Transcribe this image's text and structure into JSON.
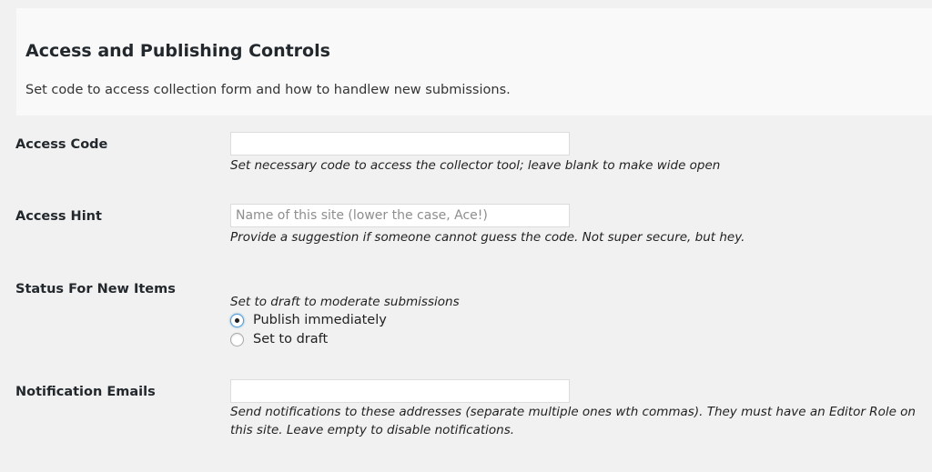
{
  "section": {
    "title": "Access and Publishing Controls",
    "description": "Set code to access collection form and how to handlew new submissions."
  },
  "access_code": {
    "label": "Access Code",
    "value": "",
    "help": "Set necessary code to access the collector tool; leave blank to make wide open"
  },
  "access_hint": {
    "label": "Access Hint",
    "placeholder": "Name of this site (lower the case, Ace!)",
    "help": "Provide a suggestion if someone cannot guess the code. Not super secure, but hey."
  },
  "status": {
    "label": "Status For New Items",
    "help": "Set to draft to moderate submissions",
    "options": [
      {
        "label": "Publish immediately",
        "checked": true
      },
      {
        "label": "Set to draft",
        "checked": false
      }
    ]
  },
  "notification_emails": {
    "label": "Notification Emails",
    "value": "",
    "help_line1": "Send notifications to these addresses (separate multiple ones wth commas). They must have an Editor Role on",
    "help_line2": "this site. Leave empty to disable notifications."
  }
}
